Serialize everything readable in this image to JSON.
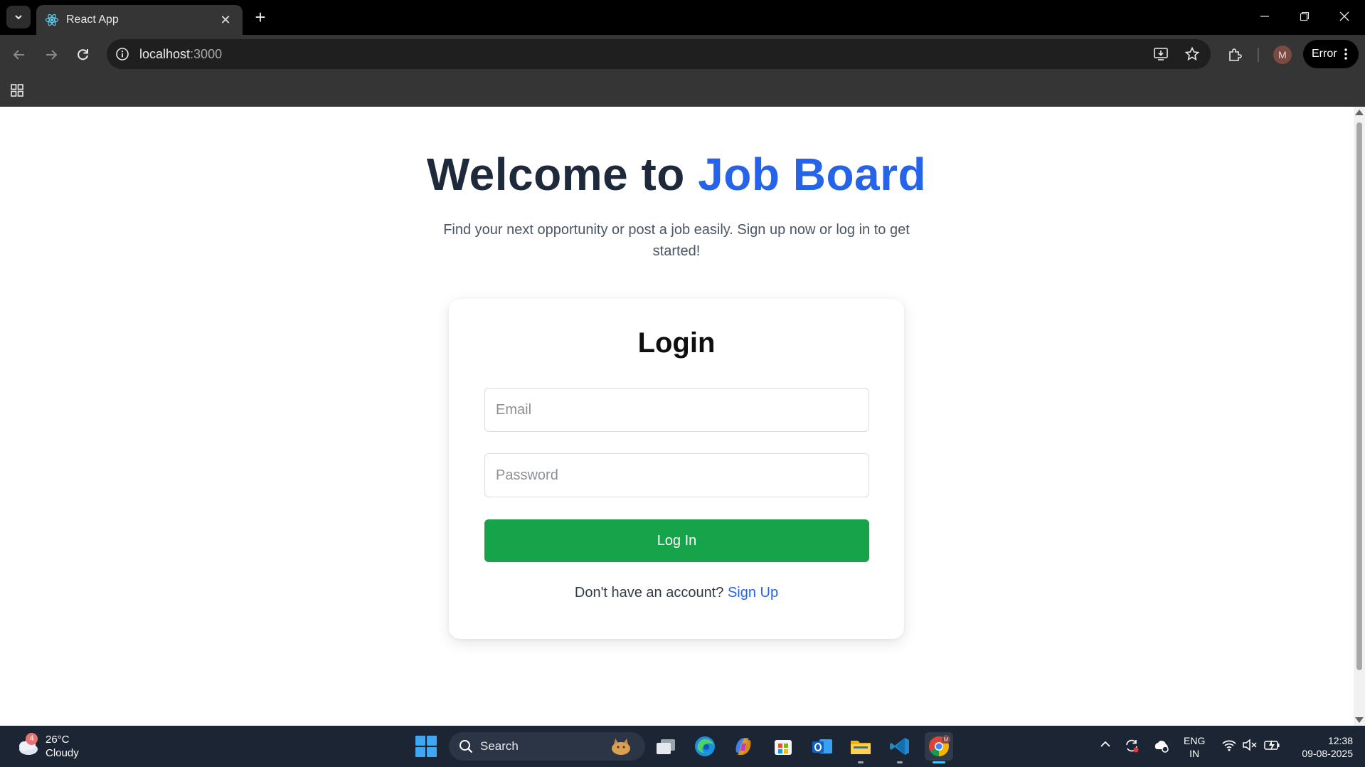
{
  "browser": {
    "tab_title": "React App",
    "url_host": "localhost",
    "url_port": ":3000",
    "profile_initial": "M",
    "error_label": "Error"
  },
  "page": {
    "heading_prefix": "Welcome to ",
    "heading_brand": "Job Board",
    "subtitle": "Find your next opportunity or post a job easily. Sign up now or log in to get started!"
  },
  "login": {
    "title": "Login",
    "email_placeholder": "Email",
    "password_placeholder": "Password",
    "button_label": "Log In",
    "signup_prompt": "Don't have an account? ",
    "signup_link": "Sign Up"
  },
  "taskbar": {
    "weather_badge": "4",
    "temperature": "26°C",
    "condition": "Cloudy",
    "search_label": "Search",
    "lang_primary": "ENG",
    "lang_secondary": "IN",
    "time": "12:38",
    "date": "09-08-2025"
  },
  "colors": {
    "brand_blue": "#2563eb",
    "login_green": "#16a34a",
    "heading_dark": "#1e293b"
  }
}
